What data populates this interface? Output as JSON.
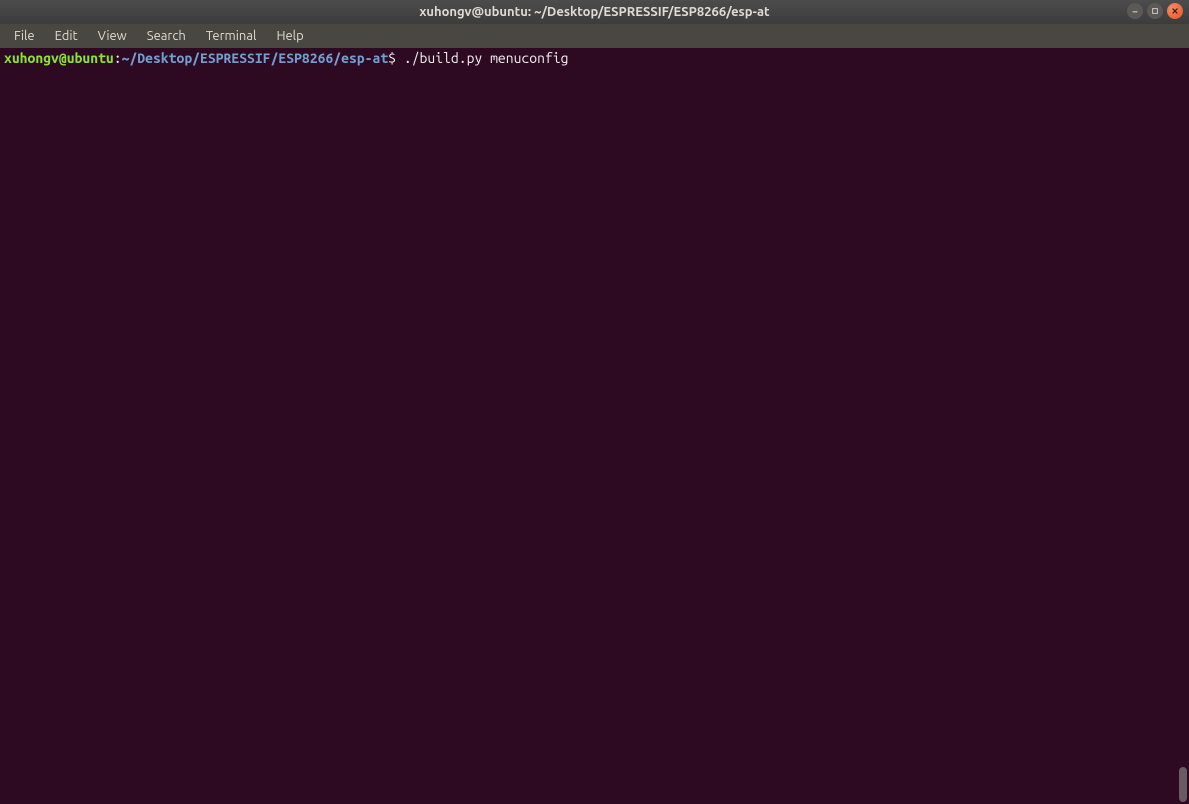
{
  "titlebar": {
    "title": "xuhongv@ubuntu: ~/Desktop/ESPRESSIF/ESP8266/esp-at"
  },
  "menubar": {
    "items": [
      "File",
      "Edit",
      "View",
      "Search",
      "Terminal",
      "Help"
    ]
  },
  "terminal": {
    "prompt": {
      "user_host": "xuhongv@ubuntu",
      "colon": ":",
      "path": "~/Desktop/ESPRESSIF/ESP8266/esp-at",
      "dollar": "$",
      "command": " ./build.py menuconfig"
    }
  }
}
